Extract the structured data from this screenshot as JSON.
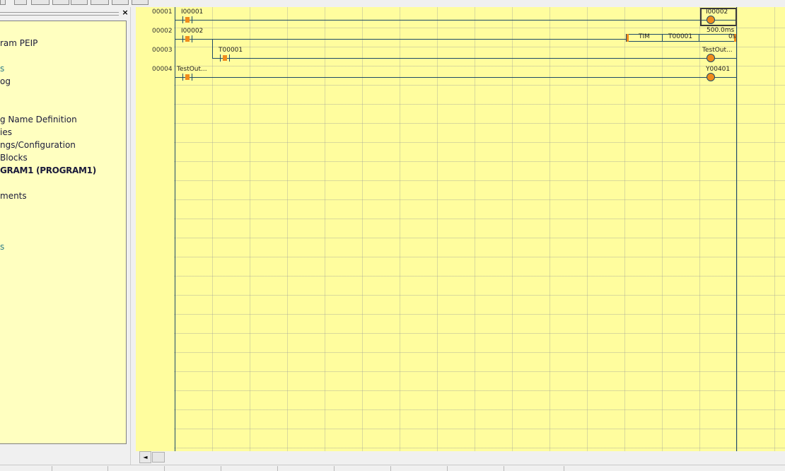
{
  "tree": {
    "close_label": "×",
    "items": [
      {
        "label": "ram PEIP",
        "style": "normal"
      },
      {
        "label": "s",
        "style": "teal"
      },
      {
        "label": "og",
        "style": "normal"
      },
      {
        "label": "g Name Definition",
        "style": "normal"
      },
      {
        "label": "ies",
        "style": "normal"
      },
      {
        "label": "ngs/Configuration",
        "style": "normal"
      },
      {
        "label": " Blocks",
        "style": "normal"
      },
      {
        "label": "GRAM1 (PROGRAM1)",
        "style": "bold"
      },
      {
        "label": "ments",
        "style": "normal"
      },
      {
        "label": "s",
        "style": "teal"
      }
    ]
  },
  "ladder": {
    "rungs": [
      {
        "number": "00001",
        "contact": "I00001",
        "output": "I00002"
      },
      {
        "number": "00002",
        "contact": "I00002",
        "fb_name": "TIM",
        "fb_operand": "T00001",
        "fb_preset": "500.0ms",
        "fb_extra": "0s"
      },
      {
        "number": "00003",
        "contact": "T00001",
        "output": "TestOut..."
      },
      {
        "number": "00004",
        "contact": "TestOut...",
        "output": "Y00401"
      }
    ]
  },
  "scrollbar": {
    "left_arrow": "◄"
  },
  "colors": {
    "canvas": "#fffd9e",
    "tree_bg": "#ffffc0",
    "contact_mark": "#f08c1c",
    "wire": "#1d4a66"
  }
}
